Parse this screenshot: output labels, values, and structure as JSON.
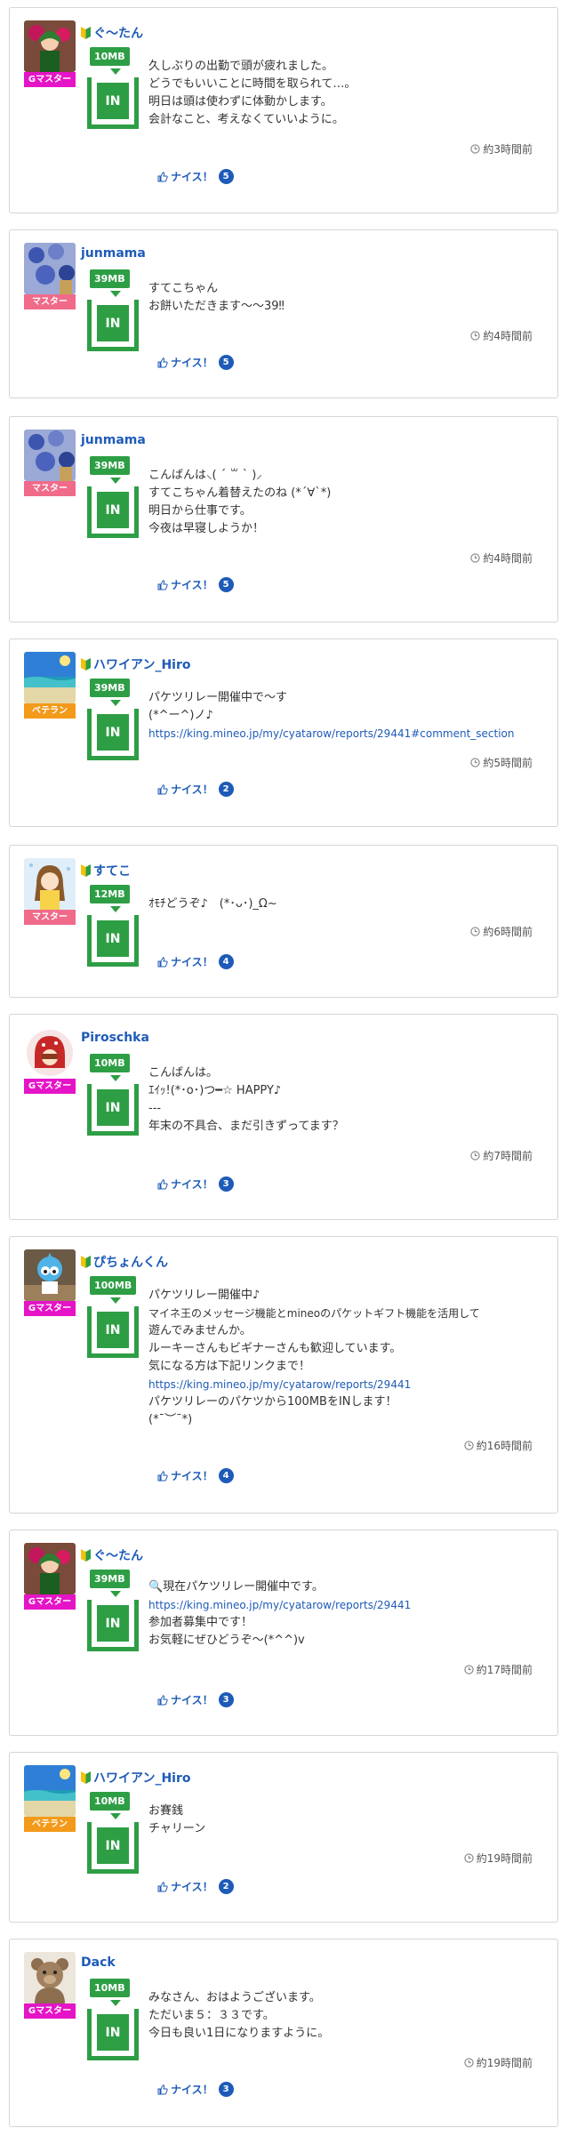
{
  "common": {
    "in_label": "IN",
    "nice_label": "ナイス！"
  },
  "colors": {
    "accent_green": "#2e9e45",
    "link_blue": "#1e5bb8",
    "g_master": "#e514c7",
    "master": "#f06a8a",
    "veteran": "#f39a1a"
  },
  "posts": [
    {
      "user": "ぐ〜たん",
      "beginner": true,
      "rank": "Gマスター",
      "mb": "10MB",
      "lines": [
        "久しぶりの出勤で頭が疲れました。",
        "どうでもいいことに時間を取られて…。",
        "明日は頭は使わずに体動かします。",
        "会計なこと、考えなくていいように。"
      ],
      "link": "",
      "time": "約3時間前",
      "nice_count": "5"
    },
    {
      "user": "junmama",
      "beginner": false,
      "rank": "マスター",
      "mb": "39MB",
      "lines": [
        "すてこちゃん",
        "お餅いただきます〜〜39‼︎"
      ],
      "link": "",
      "time": "約4時間前",
      "nice_count": "5"
    },
    {
      "user": "junmama",
      "beginner": false,
      "rank": "マスター",
      "mb": "39MB",
      "lines": [
        "こんばんは⸜( ´ ꒳ ` )⸝",
        "すてこちゃん着替えたのね (*´∀`*)",
        "明日から仕事です。",
        "今夜は早寝しようか！"
      ],
      "link": "",
      "time": "約4時間前",
      "nice_count": "5"
    },
    {
      "user": "ハワイアン_Hiro",
      "beginner": true,
      "rank": "ベテラン",
      "mb": "39MB",
      "lines": [
        "パケツリレー開催中で〜す",
        "(*^ー^)ノ♪"
      ],
      "link": "https://king.mineo.jp/my/cyatarow/reports/29441#comment_section",
      "time": "約5時間前",
      "nice_count": "2"
    },
    {
      "user": "すてこ",
      "beginner": true,
      "rank": "マスター",
      "mb": "12MB",
      "lines": [
        "ｵﾓﾁどうぞ♪　(*･ᴗ･)_Ω~"
      ],
      "link": "",
      "time": "約6時間前",
      "nice_count": "4"
    },
    {
      "user": "Piroschka",
      "beginner": false,
      "rank": "Gマスター",
      "mb": "10MB",
      "lines": [
        "こんばんは。",
        "ｴｲｯ!(*･o･)つ━☆ HAPPY♪",
        "---",
        "年末の不具合、まだ引きずってます？"
      ],
      "link": "",
      "time": "約7時間前",
      "nice_count": "3"
    },
    {
      "user": "ぴちょんくん",
      "beginner": true,
      "rank": "Gマスター",
      "mb": "100MB",
      "lines": [
        "パケツリレー開催中♪",
        "マイネ王のメッセージ機能とmineoのパケットギフト機能を活用して",
        "遊んでみませんか。",
        "ルーキーさんもビギナーさんも歓迎しています。",
        "気になる方は下記リンクまで！"
      ],
      "link": "https://king.mineo.jp/my/cyatarow/reports/29441",
      "lines_after": [
        "パケツリレーのパケツから100MBをINします！",
        "(*¯︶¯*)"
      ],
      "time": "約16時間前",
      "nice_count": "4"
    },
    {
      "user": "ぐ〜たん",
      "beginner": true,
      "rank": "Gマスター",
      "mb": "39MB",
      "lines": [
        "🔍現在パケツリレー開催中です。"
      ],
      "link": "https://king.mineo.jp/my/cyatarow/reports/29441",
      "lines_after": [
        "参加者募集中です！",
        "お気軽にぜひどうぞ〜(*^^)v"
      ],
      "time": "約17時間前",
      "nice_count": "3"
    },
    {
      "user": "ハワイアン_Hiro",
      "beginner": true,
      "rank": "ベテラン",
      "mb": "10MB",
      "lines": [
        "お賽銭",
        "チャリーン"
      ],
      "link": "",
      "time": "約19時間前",
      "nice_count": "2"
    },
    {
      "user": "Dack",
      "beginner": false,
      "rank": "Gマスター",
      "mb": "10MB",
      "lines": [
        "みなさん、おはようございます。",
        "ただいま５：３３です。",
        "今日も良い1日になりますように。"
      ],
      "link": "",
      "time": "約19時間前",
      "nice_count": "3"
    }
  ]
}
